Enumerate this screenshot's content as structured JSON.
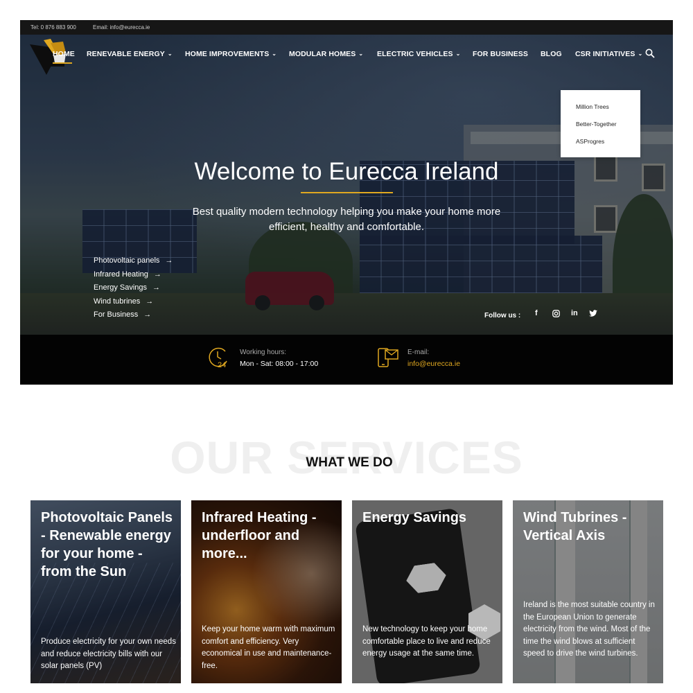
{
  "topbar": {
    "tel": "Tel: 0 876 883 900",
    "email": "Email: info@eurecca.ie"
  },
  "nav": {
    "items": [
      {
        "label": "HOME",
        "dropdown": false
      },
      {
        "label": "RENEVABLE ENERGY",
        "dropdown": true
      },
      {
        "label": "HOME IMPROVEMENTS",
        "dropdown": true
      },
      {
        "label": "MODULAR HOMES",
        "dropdown": true
      },
      {
        "label": "ELECTRIC VEHICLES",
        "dropdown": true
      },
      {
        "label": "FOR BUSINESS",
        "dropdown": false
      },
      {
        "label": "BLOG",
        "dropdown": false
      },
      {
        "label": "CSR INITIATIVES",
        "dropdown": true
      }
    ],
    "csr_menu": [
      "Million Trees",
      "Better-Together",
      "ASProgres"
    ],
    "accent": "#e0a820"
  },
  "hero": {
    "title": "Welcome to Eurecca Ireland",
    "subtitle_line1": "Best quality modern technology helping you make your home more",
    "subtitle_line2": "efficient, healthy and comfortable.",
    "links": [
      "Photovoltaic panels",
      "Infrared Heating",
      "Energy Savings",
      "Wind tubrines",
      "For Business"
    ],
    "follow_label": "Follow us :",
    "social_icons": [
      "facebook-icon",
      "instagram-icon",
      "linkedin-icon",
      "twitter-icon"
    ]
  },
  "info": {
    "hours_label": "Working hours:",
    "hours_value": "Mon - Sat: 08:00 - 17:00",
    "email_label": "E-mail:",
    "email_value": "info@eurecca.ie",
    "hours_icon_text": "24"
  },
  "services": {
    "bg_title": "OUR SERVICES",
    "title": "WHAT WE DO",
    "cards": [
      {
        "title": "Photovoltaic Panels - Renewable energy for your home - from the Sun",
        "text": "Produce electricity for your own needs and reduce electricity bills with our solar panels (PV)"
      },
      {
        "title": "Infrared Heating - underfloor and more...",
        "text": "Keep your home warm with maximum comfort and efficiency. Very economical in use and maintenance-free."
      },
      {
        "title": "Energy Savings",
        "text": "New technology to keep your home comfortable place to live and reduce energy usage at the same time."
      },
      {
        "title": "Wind Tubrines - Vertical Axis",
        "text": "Ireland is the most suitable country in the European Union to generate electricity from the wind. Most of the time the wind blows at sufficient speed to drive the wind turbines."
      }
    ]
  }
}
